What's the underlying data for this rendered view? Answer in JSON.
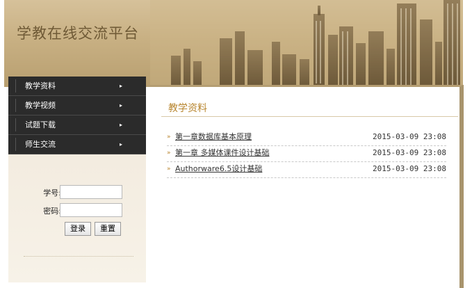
{
  "header": {
    "site_title": "学教在线交流平台"
  },
  "sidebar": {
    "menu": [
      {
        "label": "教学资料"
      },
      {
        "label": "教学视频"
      },
      {
        "label": "试题下载"
      },
      {
        "label": "师生交流"
      }
    ],
    "arrow_glyph": "▸"
  },
  "login": {
    "student_id_label": "学号:",
    "student_id_value": "",
    "password_label": "密码:",
    "password_value": "",
    "login_button": "登录",
    "reset_button": "重置"
  },
  "main": {
    "section_title": "教学资料",
    "bullet": "»",
    "items": [
      {
        "title": "第一章数据库基本原理",
        "date": "2015-03-09 23:08"
      },
      {
        "title": "第一章 多媒体课件设计基础",
        "date": "2015-03-09 23:08"
      },
      {
        "title": "Authorware6.5设计基础",
        "date": "2015-03-09 23:08"
      }
    ]
  },
  "colors": {
    "header_bg": "#c8b083",
    "menu_bg": "#2b2b2b",
    "accent": "#b8862f",
    "frame_border": "#a8946c"
  }
}
